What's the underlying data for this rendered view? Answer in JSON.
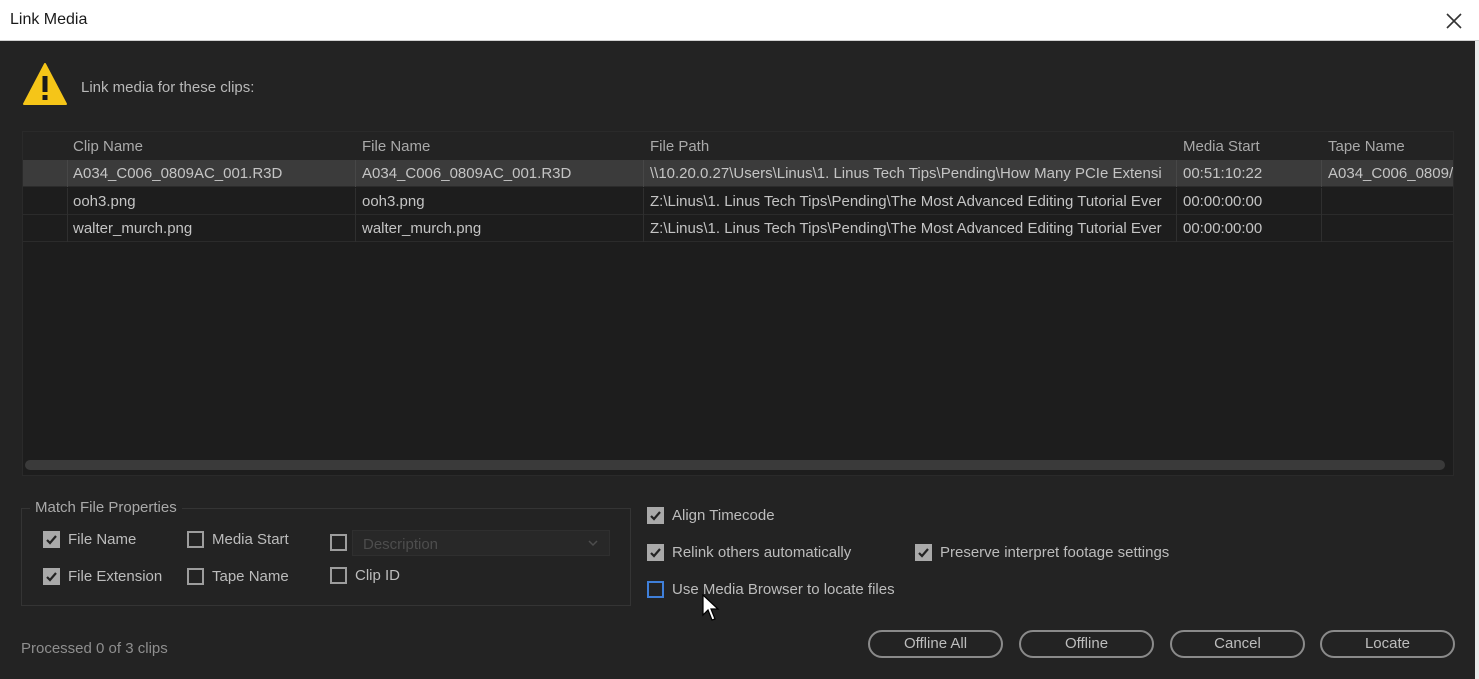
{
  "window": {
    "title": "Link Media"
  },
  "header": {
    "prompt": "Link media for these clips:",
    "icon": "warning-icon"
  },
  "table": {
    "columns": [
      "Clip Name",
      "File Name",
      "File Path",
      "Media Start",
      "Tape Name"
    ],
    "rows": [
      {
        "clip": "A034_C006_0809AC_001.R3D",
        "file": "A034_C006_0809AC_001.R3D",
        "path": "\\\\10.20.0.27\\Users\\Linus\\1. Linus Tech Tips\\Pending\\How Many PCIe Extensi",
        "start": "00:51:10:22",
        "tape": "A034_C006_0809/"
      },
      {
        "clip": "ooh3.png",
        "file": "ooh3.png",
        "path": "Z:\\Linus\\1. Linus Tech Tips\\Pending\\The Most Advanced Editing Tutorial Ever",
        "start": "00:00:00:00",
        "tape": ""
      },
      {
        "clip": "walter_murch.png",
        "file": "walter_murch.png",
        "path": "Z:\\Linus\\1. Linus Tech Tips\\Pending\\The Most Advanced Editing Tutorial Ever",
        "start": "00:00:00:00",
        "tape": ""
      }
    ]
  },
  "match": {
    "legend": "Match File Properties",
    "file_name": {
      "label": "File Name",
      "checked": true
    },
    "file_extension": {
      "label": "File Extension",
      "checked": true
    },
    "media_start": {
      "label": "Media Start",
      "checked": false
    },
    "tape_name": {
      "label": "Tape Name",
      "checked": false
    },
    "description": {
      "label": "Description",
      "checked": false
    },
    "clip_id": {
      "label": "Clip ID",
      "checked": false
    }
  },
  "options": {
    "align_timecode": {
      "label": "Align Timecode",
      "checked": true
    },
    "relink_others": {
      "label": "Relink others automatically",
      "checked": true
    },
    "preserve_interpret": {
      "label": "Preserve interpret footage settings",
      "checked": true
    },
    "use_media_browser": {
      "label": "Use Media Browser to locate files",
      "checked": false
    }
  },
  "status": "Processed 0 of 3 clips",
  "buttons": {
    "offline_all": "Offline All",
    "offline": "Offline",
    "cancel": "Cancel",
    "locate": "Locate"
  },
  "colors": {
    "background": "#232323",
    "selected_row": "#3b3b3b",
    "focus_outline": "#3f7fd9",
    "warning": "#f5c518"
  }
}
